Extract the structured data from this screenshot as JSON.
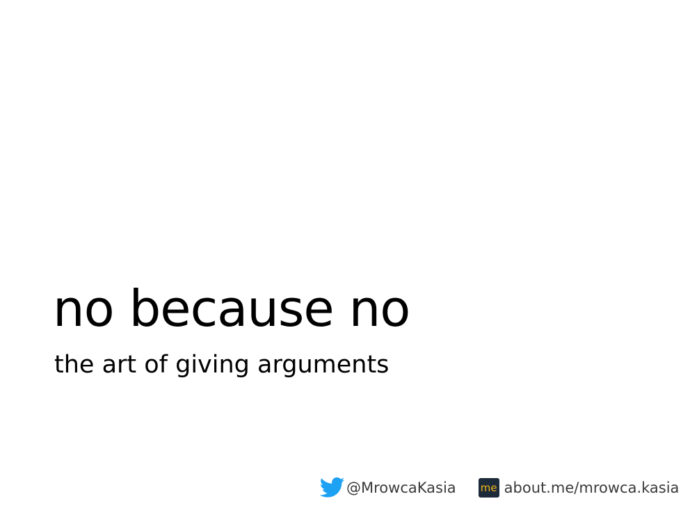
{
  "slide": {
    "title": "no because no",
    "subtitle": "the art of giving arguments"
  },
  "footer": {
    "twitter": {
      "icon": "twitter-bird-icon",
      "color": "#1da1f2",
      "handle": "@MrowcaKasia"
    },
    "aboutme": {
      "icon": "about-me-icon",
      "icon_text": "me",
      "icon_bg": "#1c2a3a",
      "icon_color": "#f3b71a",
      "url": "about.me/mrowca.kasia"
    }
  }
}
